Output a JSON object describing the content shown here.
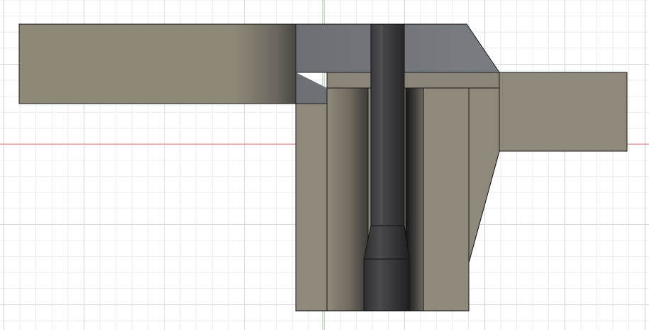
{
  "viewport": {
    "name": "3d-modeling-viewport",
    "view": "section view"
  },
  "colors": {
    "background": "#ffffff",
    "grid_major": "#d3d3d3",
    "grid_minor": "#ececec",
    "axis_horizontal": "#e88a96",
    "axis_vertical": "#7fd98a",
    "body_beige": "#8e897b",
    "body_grey_cap": "#727579",
    "pin_dark": "#3e3e40",
    "outline": "#1a1a1a"
  },
  "parts": [
    {
      "name": "left-arm",
      "color": "body_beige"
    },
    {
      "name": "right-arm",
      "color": "body_beige"
    },
    {
      "name": "grey-cap",
      "color": "body_grey_cap"
    },
    {
      "name": "housing-body",
      "color": "body_beige"
    },
    {
      "name": "center-pin",
      "color": "pin_dark"
    }
  ]
}
